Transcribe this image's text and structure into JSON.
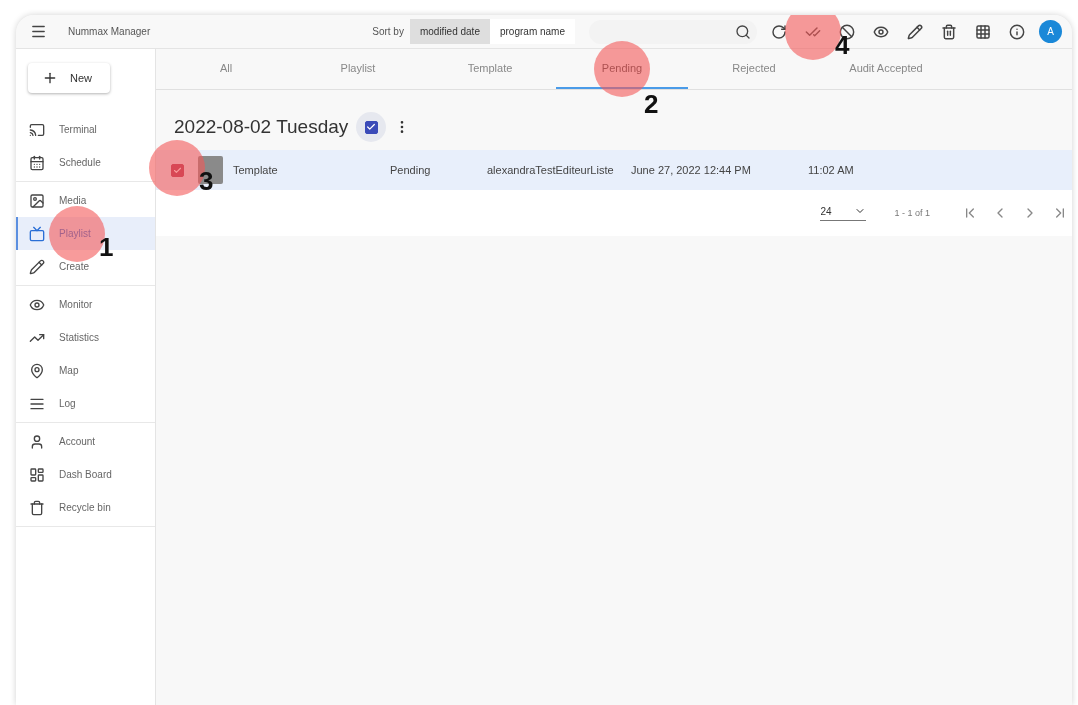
{
  "app": {
    "title": "Nummax Manager"
  },
  "sort": {
    "label": "Sort by",
    "options": [
      {
        "label": "modified date",
        "selected": true
      },
      {
        "label": "program name",
        "selected": false
      }
    ]
  },
  "toolbar_buttons": [
    {
      "kind": "refresh"
    },
    {
      "kind": "approve",
      "annotation": "4"
    },
    {
      "kind": "reject"
    },
    {
      "kind": "preview"
    },
    {
      "kind": "edit"
    },
    {
      "kind": "delete"
    },
    {
      "kind": "grid"
    },
    {
      "kind": "info"
    }
  ],
  "avatar": "A",
  "new_button": "New",
  "sidebar_groups": [
    [
      {
        "kind": "terminal",
        "label": "Terminal",
        "selected": false
      },
      {
        "kind": "schedule",
        "label": "Schedule",
        "selected": false
      }
    ],
    [
      {
        "kind": "media",
        "label": "Media",
        "selected": false
      },
      {
        "kind": "playlist",
        "label": "Playlist",
        "selected": true,
        "annotation": "1"
      },
      {
        "kind": "create",
        "label": "Create",
        "selected": false
      }
    ],
    [
      {
        "kind": "monitor",
        "label": "Monitor",
        "selected": false
      },
      {
        "kind": "statistics",
        "label": "Statistics",
        "selected": false
      },
      {
        "kind": "map",
        "label": "Map",
        "selected": false
      },
      {
        "kind": "log",
        "label": "Log",
        "selected": false
      }
    ],
    [
      {
        "kind": "account",
        "label": "Account",
        "selected": false
      },
      {
        "kind": "dashboard",
        "label": "Dash Board",
        "selected": false
      },
      {
        "kind": "recycle",
        "label": "Recycle bin",
        "selected": false
      }
    ]
  ],
  "tabs": [
    {
      "label": "All",
      "selected": false
    },
    {
      "label": "Playlist",
      "selected": false
    },
    {
      "label": "Template",
      "selected": false
    },
    {
      "label": "Pending",
      "selected": true,
      "annotation": "2"
    },
    {
      "label": "Rejected",
      "selected": false
    },
    {
      "label": "Audit Accepted",
      "selected": false
    }
  ],
  "group": {
    "date": "2022-08-02 Tuesday",
    "checked": true
  },
  "rows": [
    {
      "checked": true,
      "selected": true,
      "annotation": "3",
      "cells": [
        "Template",
        "Pending",
        "alexandraTestEditeurListe",
        "June 27, 2022 12:44 PM",
        "11:02 AM"
      ]
    }
  ],
  "pagination": {
    "per_page": "24",
    "range": "1 - 1 of 1"
  }
}
